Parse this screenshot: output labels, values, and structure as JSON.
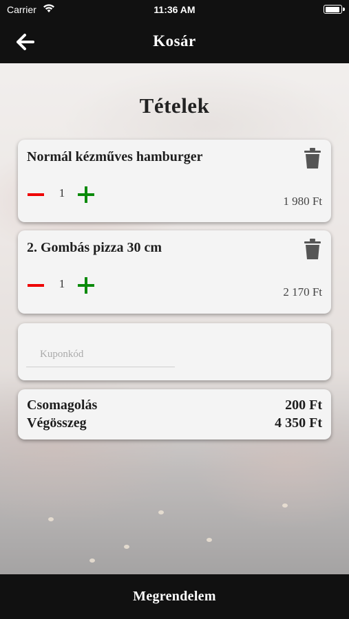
{
  "status_bar": {
    "carrier": "Carrier",
    "time": "11:36 AM"
  },
  "nav": {
    "title": "Kosár",
    "back_icon": "arrow-left-icon"
  },
  "section_title": "Tételek",
  "cart_items": [
    {
      "name": "Normál kézműves hamburger",
      "quantity": "1",
      "price": "1 980 Ft"
    },
    {
      "name": "2. Gombás pizza 30 cm",
      "quantity": "1",
      "price": "2 170 Ft"
    }
  ],
  "coupon": {
    "placeholder": "Kuponkód",
    "value": ""
  },
  "summary": {
    "packaging_label": "Csomagolás",
    "packaging_value": "200 Ft",
    "total_label": "Végösszeg",
    "total_value": "4 350 Ft"
  },
  "order_button": "Megrendelem",
  "colors": {
    "bar": "#111111",
    "minus": "#e00000",
    "plus": "#0a8a0a",
    "card": "#f4f4f4"
  }
}
